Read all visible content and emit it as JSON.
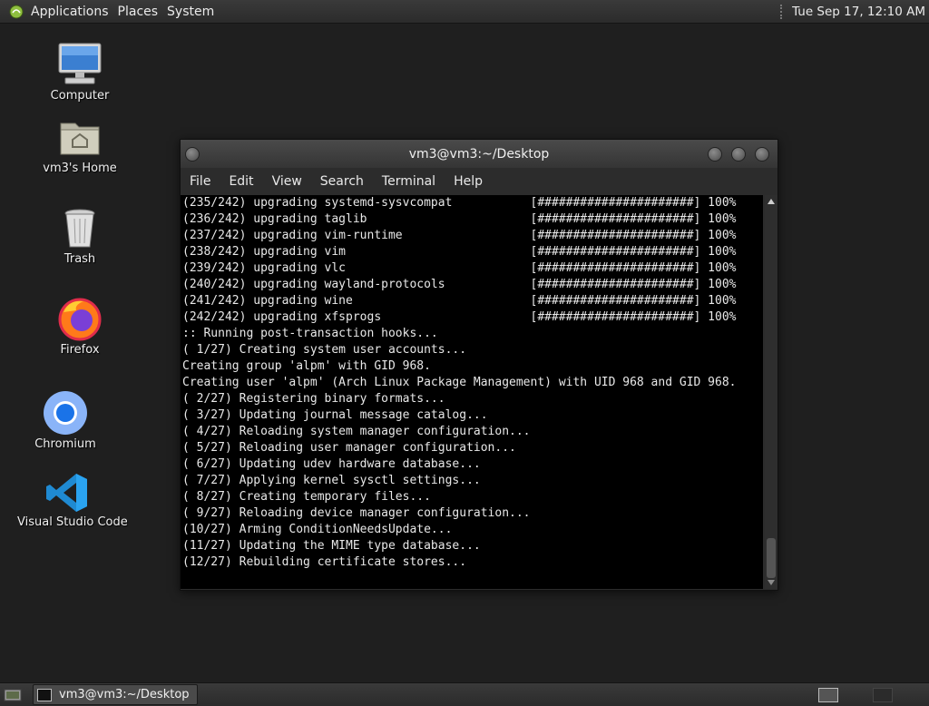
{
  "top_panel": {
    "menus": [
      "Applications",
      "Places",
      "System"
    ],
    "clock": "Tue Sep 17, 12:10 AM"
  },
  "desktop_icons": [
    {
      "label": "Computer",
      "icon": "computer-icon"
    },
    {
      "label": "vm3's Home",
      "icon": "home-folder-icon"
    },
    {
      "label": "Trash",
      "icon": "trash-icon"
    },
    {
      "label": "Firefox",
      "icon": "firefox-icon"
    },
    {
      "label": "Chromium",
      "icon": "chromium-icon"
    },
    {
      "label": "Visual Studio Code",
      "icon": "vscode-icon"
    }
  ],
  "window": {
    "title": "vm3@vm3:~/Desktop",
    "menus": [
      "File",
      "Edit",
      "View",
      "Search",
      "Terminal",
      "Help"
    ],
    "terminal_lines": [
      "(235/242) upgrading systemd-sysvcompat           [######################] 100%",
      "(236/242) upgrading taglib                       [######################] 100%",
      "(237/242) upgrading vim-runtime                  [######################] 100%",
      "(238/242) upgrading vim                          [######################] 100%",
      "(239/242) upgrading vlc                          [######################] 100%",
      "(240/242) upgrading wayland-protocols            [######################] 100%",
      "(241/242) upgrading wine                         [######################] 100%",
      "(242/242) upgrading xfsprogs                     [######################] 100%",
      ":: Running post-transaction hooks...",
      "( 1/27) Creating system user accounts...",
      "Creating group 'alpm' with GID 968.",
      "Creating user 'alpm' (Arch Linux Package Management) with UID 968 and GID 968.",
      "( 2/27) Registering binary formats...",
      "( 3/27) Updating journal message catalog...",
      "( 4/27) Reloading system manager configuration...",
      "( 5/27) Reloading user manager configuration...",
      "( 6/27) Updating udev hardware database...",
      "( 7/27) Applying kernel sysctl settings...",
      "( 8/27) Creating temporary files...",
      "( 9/27) Reloading device manager configuration...",
      "(10/27) Arming ConditionNeedsUpdate...",
      "(11/27) Updating the MIME type database...",
      "(12/27) Rebuilding certificate stores..."
    ]
  },
  "taskbar": {
    "task_label": "vm3@vm3:~/Desktop"
  }
}
